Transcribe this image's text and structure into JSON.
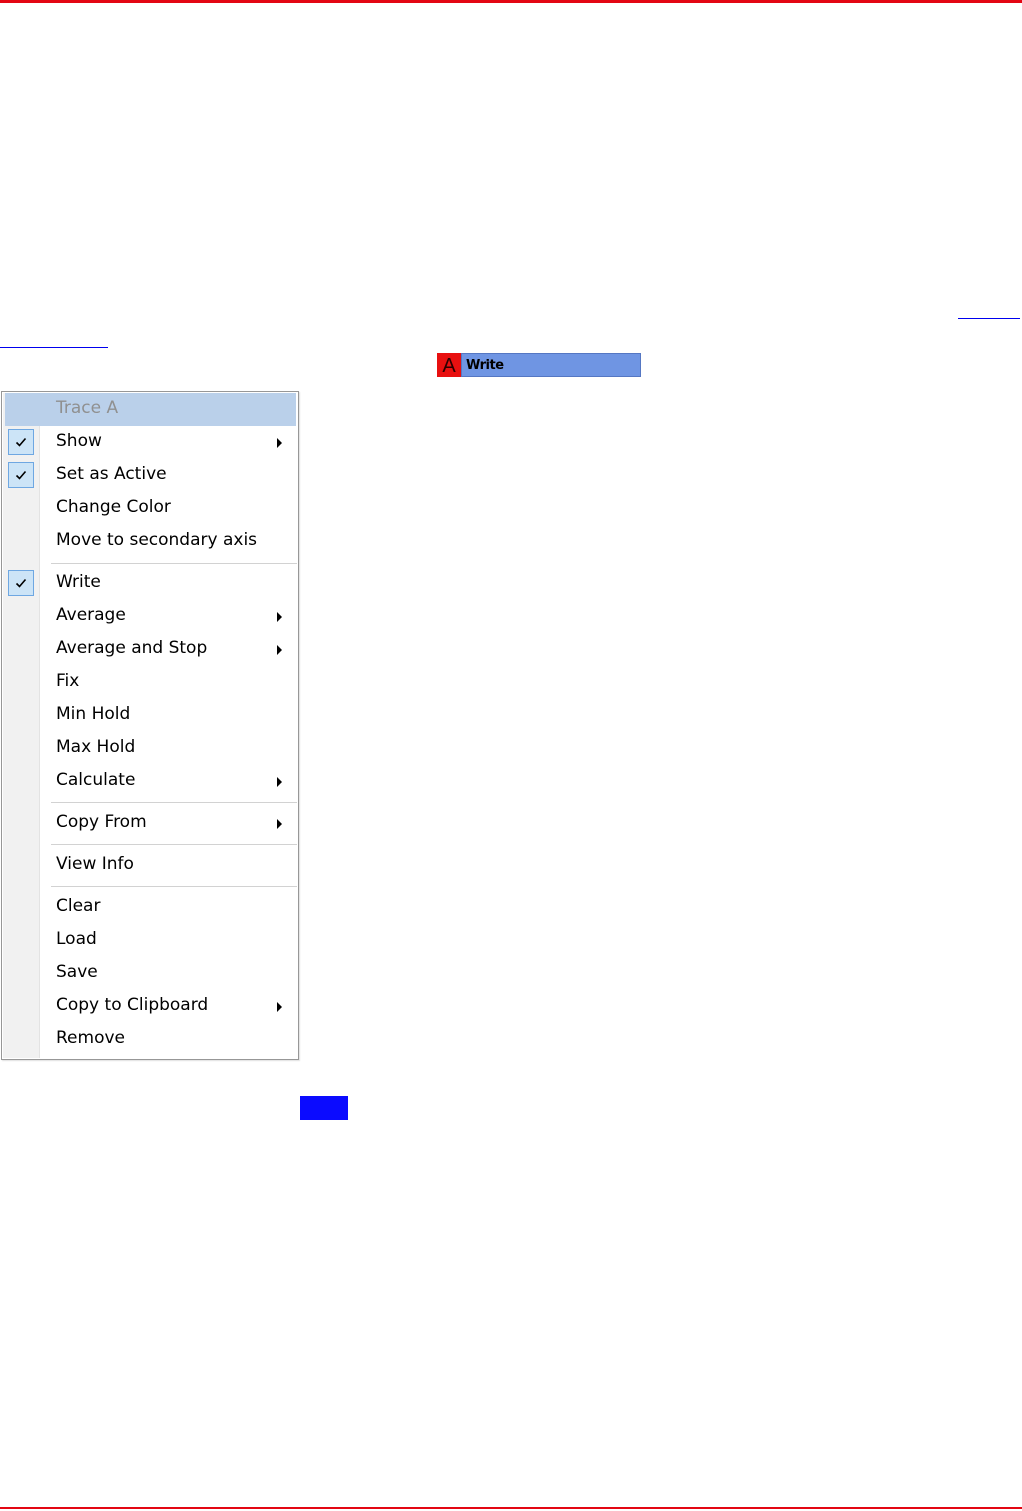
{
  "colors": {
    "page_rule": "#e30613",
    "trace_letter_bg": "#e81010",
    "trace_mode_bg": "#6f95e3",
    "menu_header_bg": "#bad0ea",
    "check_box_bg": "#cce4f7",
    "blue_swatch": "#0b0bff"
  },
  "trace_bar": {
    "letter": "A",
    "mode": "Write"
  },
  "context_menu": {
    "header": "Trace A",
    "items": [
      {
        "label": "Show",
        "checked": true,
        "submenu": true,
        "icon": "checkmark-icon"
      },
      {
        "label": "Set as Active",
        "checked": true,
        "submenu": false,
        "icon": "checkmark-icon"
      },
      {
        "label": "Change Color",
        "checked": false,
        "submenu": false
      },
      {
        "label": "Move to secondary axis",
        "checked": false,
        "submenu": false
      },
      {
        "label": "Write",
        "checked": true,
        "submenu": false,
        "icon": "checkmark-icon"
      },
      {
        "label": "Average",
        "checked": false,
        "submenu": true
      },
      {
        "label": "Average and Stop",
        "checked": false,
        "submenu": true
      },
      {
        "label": "Fix",
        "checked": false,
        "submenu": false
      },
      {
        "label": "Min Hold",
        "checked": false,
        "submenu": false
      },
      {
        "label": "Max Hold",
        "checked": false,
        "submenu": false
      },
      {
        "label": "Calculate",
        "checked": false,
        "submenu": true
      },
      {
        "label": "Copy From",
        "checked": false,
        "submenu": true
      },
      {
        "label": "View Info",
        "checked": false,
        "submenu": false
      },
      {
        "label": "Clear",
        "checked": false,
        "submenu": false
      },
      {
        "label": "Load",
        "checked": false,
        "submenu": false
      },
      {
        "label": "Save",
        "checked": false,
        "submenu": false
      },
      {
        "label": "Copy to Clipboard",
        "checked": false,
        "submenu": true
      },
      {
        "label": "Remove",
        "checked": false,
        "submenu": false
      }
    ]
  }
}
